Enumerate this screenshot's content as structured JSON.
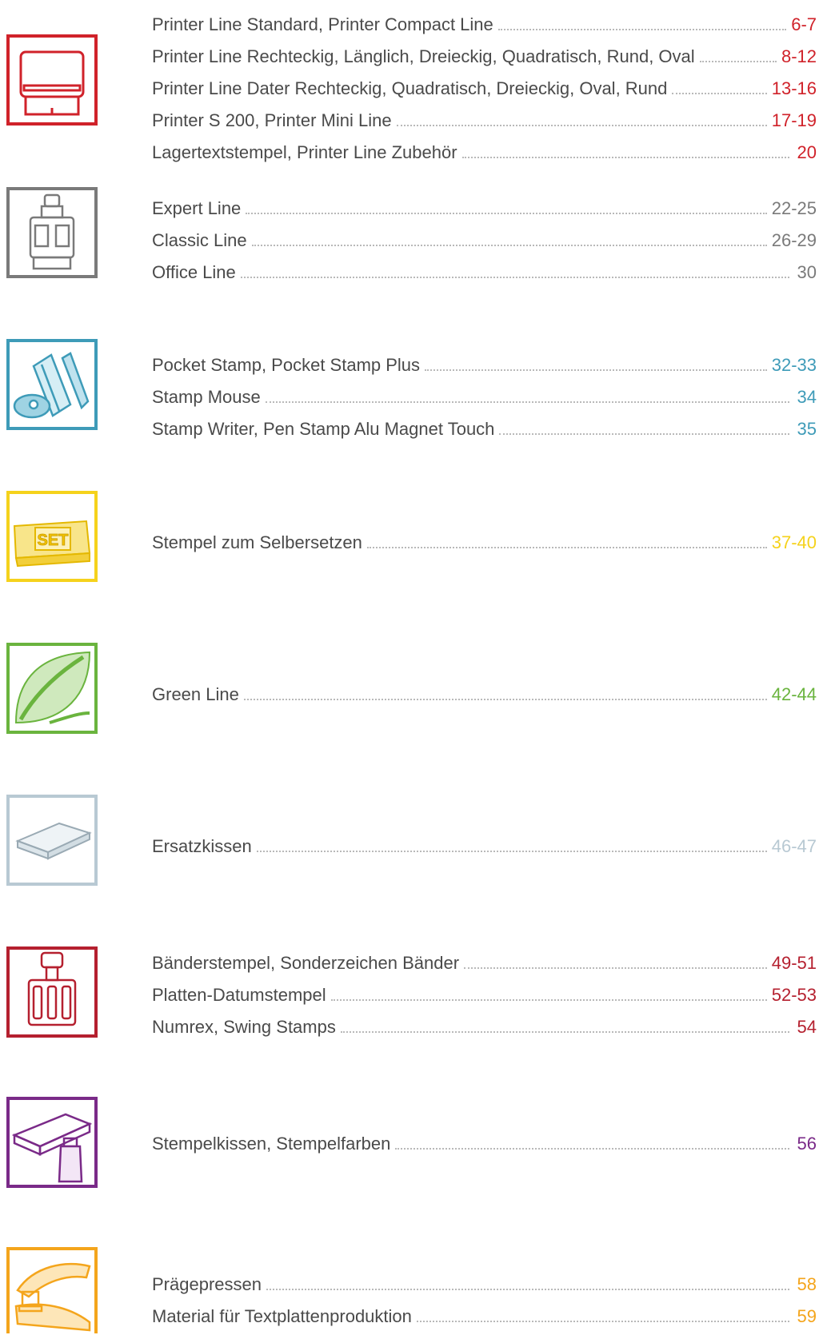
{
  "sections": [
    {
      "id": "printer",
      "icon": "self-inking-stamp-icon",
      "color": "#d0222a",
      "entries": [
        {
          "label": "Printer Line Standard, Printer Compact Line",
          "pages": "6-7"
        },
        {
          "label": "Printer Line Rechteckig, Länglich, Dreieckig, Quadratisch, Rund, Oval",
          "pages": "8-12"
        },
        {
          "label": "Printer Line Dater Rechteckig, Quadratisch, Dreieckig, Oval, Rund",
          "pages": "13-16"
        },
        {
          "label": "Printer S 200, Printer Mini Line",
          "pages": "17-19"
        },
        {
          "label": "Lagertextstempel, Printer Line Zubehör",
          "pages": "20"
        }
      ]
    },
    {
      "id": "professional",
      "icon": "dater-stamp-icon",
      "color": "#7a7a7a",
      "entries": [
        {
          "label": "Expert Line",
          "pages": "22-25"
        },
        {
          "label": "Classic Line",
          "pages": "26-29"
        },
        {
          "label": "Office Line",
          "pages": "30"
        }
      ]
    },
    {
      "id": "mobile",
      "icon": "pocket-stamp-pen-icon",
      "color": "#3e9bb8",
      "entries": [
        {
          "label": "Pocket Stamp, Pocket Stamp Plus",
          "pages": "32-33"
        },
        {
          "label": "Stamp Mouse",
          "pages": "34"
        },
        {
          "label": "Stamp Writer, Pen Stamp Alu Magnet Touch",
          "pages": "35"
        }
      ]
    },
    {
      "id": "diy",
      "icon": "set-kit-icon",
      "color": "#f5d21c",
      "icon_text": "SET",
      "entries": [
        {
          "label": "Stempel zum Selbersetzen",
          "pages": "37-40"
        }
      ]
    },
    {
      "id": "green",
      "icon": "leaf-icon",
      "color": "#6ab43e",
      "entries": [
        {
          "label": "Green Line",
          "pages": "42-44"
        }
      ]
    },
    {
      "id": "pads",
      "icon": "replacement-pad-icon",
      "color": "#b8c9d3",
      "entries": [
        {
          "label": "Ersatzkissen",
          "pages": "46-47"
        }
      ]
    },
    {
      "id": "band",
      "icon": "band-stamp-icon",
      "color": "#b5202f",
      "entries": [
        {
          "label": "Bänderstempel, Sonderzeichen Bänder",
          "pages": "49-51"
        },
        {
          "label": "Platten-Datumstempel",
          "pages": "52-53"
        },
        {
          "label": "Numrex, Swing Stamps",
          "pages": "54"
        }
      ]
    },
    {
      "id": "inkpads",
      "icon": "ink-pad-bottle-icon",
      "color": "#7a2a88",
      "entries": [
        {
          "label": "Stempelkissen, Stempelfarben",
          "pages": "56"
        }
      ]
    },
    {
      "id": "embossers",
      "icon": "embosser-icon",
      "color": "#f4a51c",
      "entries": [
        {
          "label": "Prägepressen",
          "pages": "58"
        },
        {
          "label": "Material für Textplattenproduktion",
          "pages": "59"
        }
      ]
    }
  ]
}
